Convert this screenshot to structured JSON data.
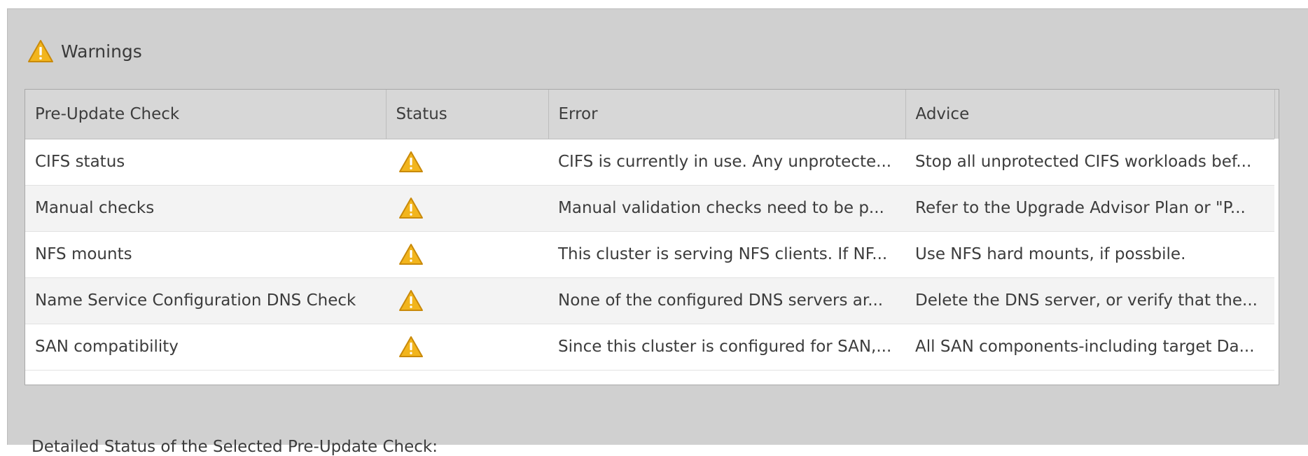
{
  "warnings": {
    "title": "Warnings",
    "icon": "warning-icon"
  },
  "table": {
    "columns": [
      "Pre-Update Check",
      "Status",
      "Error",
      "Advice"
    ],
    "settings_icon": "gear-icon",
    "rows": [
      {
        "check": "CIFS status",
        "status_icon": "warning-icon",
        "error": "CIFS is currently in use. Any unprotecte...",
        "advice": "Stop all unprotected CIFS workloads bef..."
      },
      {
        "check": "Manual checks",
        "status_icon": "warning-icon",
        "error": "Manual validation checks need to be p...",
        "advice": "Refer to the Upgrade Advisor Plan or \"P..."
      },
      {
        "check": "NFS mounts",
        "status_icon": "warning-icon",
        "error": "This cluster is serving NFS clients. If NF...",
        "advice": "Use NFS hard mounts, if possbile."
      },
      {
        "check": "Name Service Configuration DNS Check",
        "status_icon": "warning-icon",
        "error": "None of the configured DNS servers ar...",
        "advice": "Delete the DNS server, or verify that the..."
      },
      {
        "check": "SAN compatibility",
        "status_icon": "warning-icon",
        "error": "Since this cluster is configured for SAN,...",
        "advice": "All SAN components-including target Da..."
      }
    ]
  },
  "detail": {
    "label": "Detailed Status of the Selected Pre-Update Check:"
  },
  "colors": {
    "panel_bg": "#d0d0d0",
    "header_bg": "#d7d7d7",
    "warning_fill": "#f2b51d",
    "warning_stroke": "#c98a0a"
  }
}
